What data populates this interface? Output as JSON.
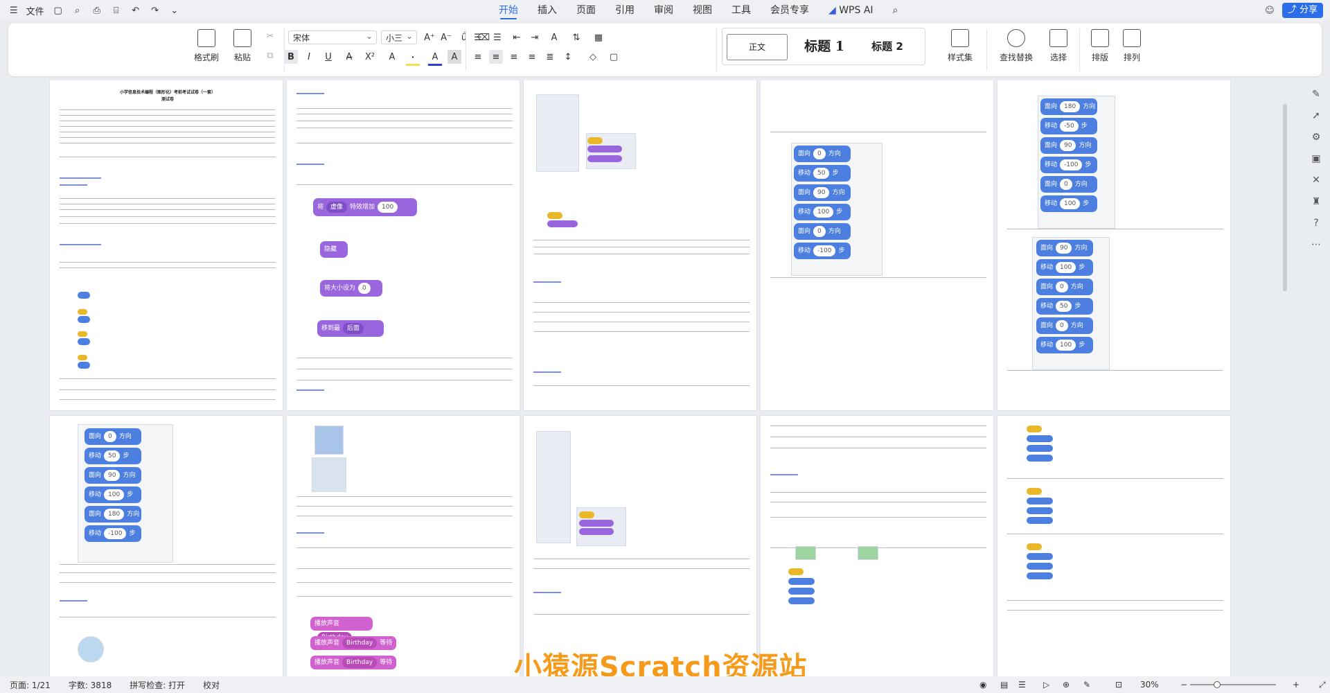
{
  "menubar": {
    "file_label": "文件",
    "tabs": [
      "开始",
      "插入",
      "页面",
      "引用",
      "审阅",
      "视图",
      "工具",
      "会员专享"
    ],
    "active_tab": "开始",
    "wps_ai": "WPS AI",
    "share": "分享"
  },
  "ribbon": {
    "format_painter": "格式刷",
    "paste": "粘贴",
    "font_name": "宋体",
    "font_size": "小三",
    "styles": [
      "正文",
      "标题 1",
      "标题 2"
    ],
    "style_set": "样式集",
    "find_replace": "查找替换",
    "select": "选择",
    "layout": "排版",
    "arrange": "排列"
  },
  "pages": {
    "p1_title": "小学信息技术编程（图形化）考前考试试卷（一套）",
    "p1_sub": "测试卷",
    "p2_blocks": [
      {
        "kind": "purple",
        "text": "将",
        "dd": "虚像",
        "text2": "特效增加",
        "val": "100"
      },
      {
        "kind": "purple",
        "text": "隐藏"
      },
      {
        "kind": "purple",
        "text": "将大小设为",
        "val": "0"
      },
      {
        "kind": "purple",
        "text": "移到最",
        "dd": "后面"
      }
    ],
    "p4_blocks": [
      {
        "text": "面向",
        "val": "0",
        "unit": "方向"
      },
      {
        "text": "移动",
        "val": "50",
        "unit": "步"
      },
      {
        "text": "面向",
        "val": "90",
        "unit": "方向"
      },
      {
        "text": "移动",
        "val": "100",
        "unit": "步"
      },
      {
        "text": "面向",
        "val": "0",
        "unit": "方向"
      },
      {
        "text": "移动",
        "val": "-100",
        "unit": "步"
      }
    ],
    "p5_blocks_a": [
      {
        "text": "面向",
        "val": "180",
        "unit": "方向"
      },
      {
        "text": "移动",
        "val": "-50",
        "unit": "步"
      },
      {
        "text": "面向",
        "val": "90",
        "unit": "方向"
      },
      {
        "text": "移动",
        "val": "-100",
        "unit": "步"
      },
      {
        "text": "面向",
        "val": "0",
        "unit": "方向"
      },
      {
        "text": "移动",
        "val": "100",
        "unit": "步"
      }
    ],
    "p5_blocks_b": [
      {
        "text": "面向",
        "val": "90",
        "unit": "方向"
      },
      {
        "text": "移动",
        "val": "100",
        "unit": "步"
      },
      {
        "text": "面向",
        "val": "0",
        "unit": "方向"
      },
      {
        "text": "移动",
        "val": "50",
        "unit": "步"
      },
      {
        "text": "面向",
        "val": "0",
        "unit": "方向"
      },
      {
        "text": "移动",
        "val": "100",
        "unit": "步"
      }
    ],
    "p6_blocks": [
      {
        "text": "面向",
        "val": "0",
        "unit": "方向"
      },
      {
        "text": "移动",
        "val": "50",
        "unit": "步"
      },
      {
        "text": "面向",
        "val": "90",
        "unit": "方向"
      },
      {
        "text": "移动",
        "val": "100",
        "unit": "步"
      },
      {
        "text": "面向",
        "val": "180",
        "unit": "方向"
      },
      {
        "text": "移动",
        "val": "-100",
        "unit": "步"
      }
    ],
    "p7_sound_blocks": [
      {
        "text": "播放声音",
        "dd": "Birthday"
      },
      {
        "text": "播放声音",
        "dd": "Birthday",
        "tail": "等待播完"
      },
      {
        "text": "播放声音",
        "dd": "Birthday",
        "tail": "等待播完"
      }
    ]
  },
  "statusbar": {
    "page": "页面: 1/21",
    "words": "字数: 3818",
    "spell": "拼写检查: 打开",
    "proof": "校对",
    "zoom": "30%"
  },
  "watermark": "小猿源Scratch资源站"
}
